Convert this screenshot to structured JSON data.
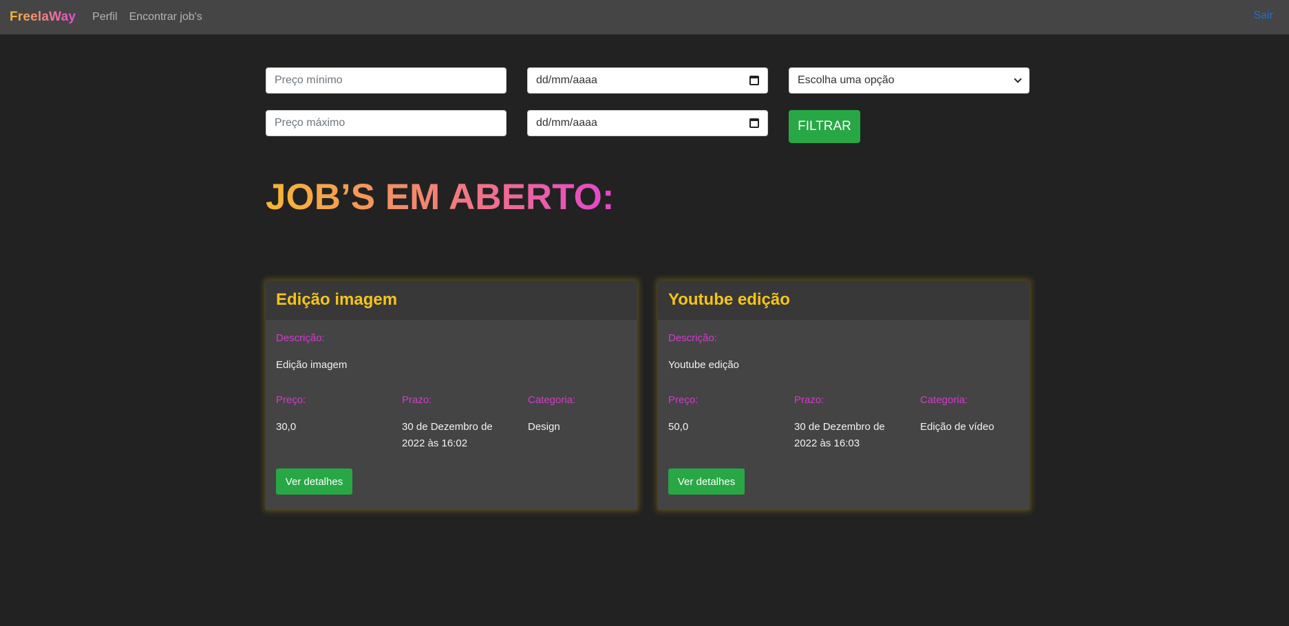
{
  "nav": {
    "brand": "FreelaWay",
    "links": [
      "Perfil",
      "Encontrar job's"
    ],
    "logout": "Sair"
  },
  "filters": {
    "min_price_placeholder": "Preço mínimo",
    "max_price_placeholder": "Preço máximo",
    "date_placeholder": "dd/mm/aaaa",
    "category_selected": "Escolha uma opção",
    "filter_button": "FILTRAR"
  },
  "heading": "JOB’S EM ABERTO:",
  "labels": {
    "description": "Descrição:",
    "price": "Preço:",
    "deadline": "Prazo:",
    "category": "Categoria:",
    "details_button": "Ver detalhes"
  },
  "jobs": [
    {
      "title": "Edição imagem",
      "description": "Edição imagem",
      "price": "30,0",
      "deadline_line1": "30 de Dezembro de",
      "deadline_line2": "2022 às 16:02",
      "category": "Design"
    },
    {
      "title": "Youtube edição",
      "description": "Youtube edição",
      "price": "50,0",
      "deadline_line1": "30 de Dezembro de",
      "deadline_line2": "2022 às 16:03",
      "category": "Edição de vídeo"
    }
  ],
  "colors": {
    "background": "#222222",
    "navbar": "#454545",
    "card": "#444444",
    "card_header": "#383838",
    "title_yellow": "#f5c518",
    "label_magenta": "#d23ccb",
    "button_green": "#28a745",
    "link_blue": "#1f6fd6"
  }
}
